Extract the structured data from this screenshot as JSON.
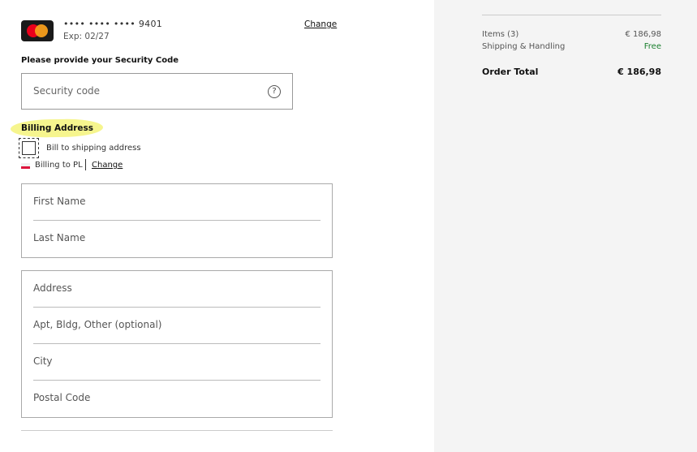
{
  "payment": {
    "card_masked": "•••• •••• •••• 9401",
    "expiry": "Exp: 02/27",
    "change_label": "Change",
    "card_icon": "mastercard-icon"
  },
  "security": {
    "label": "Please provide your Security Code",
    "placeholder": "Security code",
    "help_glyph": "?"
  },
  "billing": {
    "title": "Billing Address",
    "checkbox_label": "Bill to shipping address",
    "checkbox_checked": false,
    "billing_to": "Billing to PL",
    "change_label": "Change"
  },
  "form": {
    "name_fields": [
      "First Name",
      "Last Name"
    ],
    "address_fields": [
      "Address",
      "Apt, Bldg, Other (optional)",
      "City",
      "Postal Code"
    ]
  },
  "summary": {
    "items_label": "Items (3)",
    "items_value": "€ 186,98",
    "shipping_label": "Shipping & Handling",
    "shipping_value": "Free",
    "total_label": "Order Total",
    "total_value": "€ 186,98"
  },
  "colors": {
    "highlight": "#f5f37a",
    "free_green": "#1a7f2e",
    "summary_bg": "#f4f4f4"
  }
}
